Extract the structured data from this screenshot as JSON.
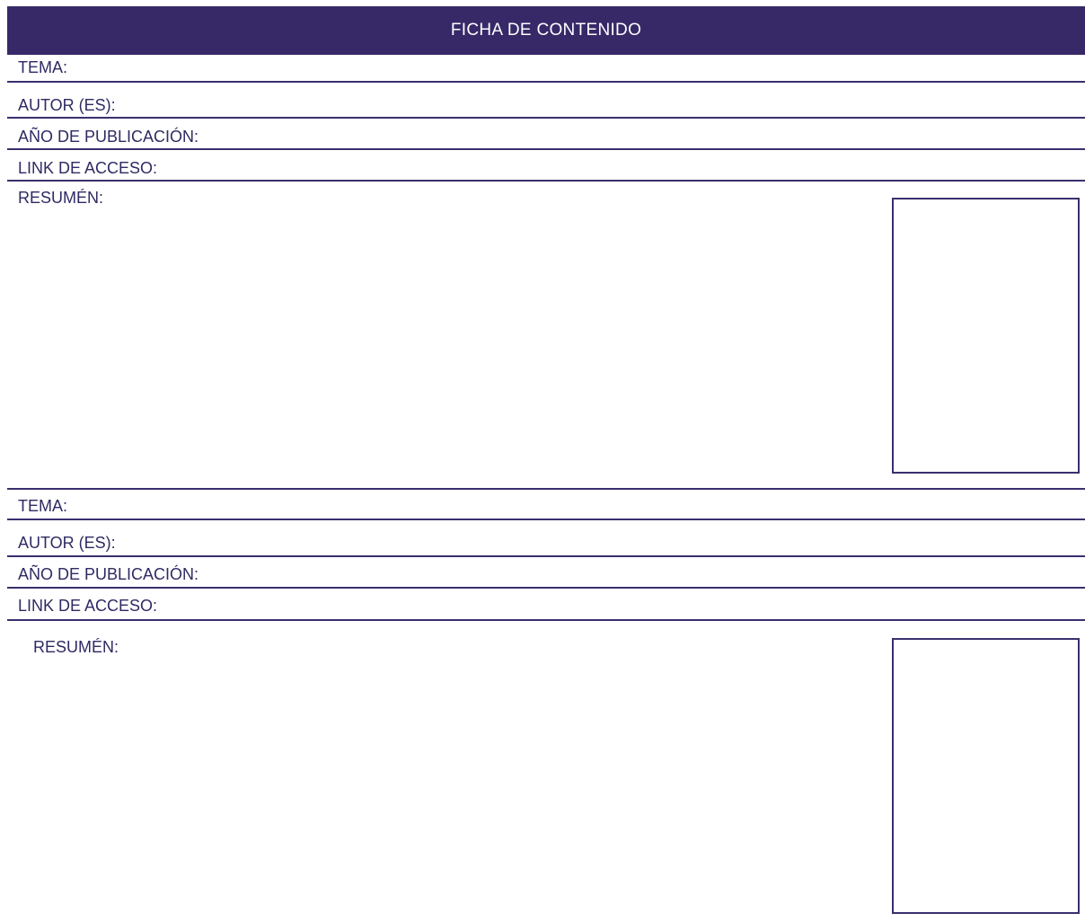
{
  "header": {
    "title": "FICHA DE CONTENIDO"
  },
  "card1": {
    "tema_label": "TEMA:",
    "autor_label": "AUTOR (ES):",
    "anio_label": "AÑO DE PUBLICACIÓN:",
    "link_label": "LINK DE ACCESO:",
    "resumen_label": "RESUMÉN:"
  },
  "card2": {
    "tema_label": "TEMA:",
    "autor_label": "AUTOR (ES):",
    "anio_label": "AÑO DE PUBLICACIÓN:",
    "link_label": "LINK DE ACCESO:",
    "resumen_label": "RESUMÉN:"
  },
  "colors": {
    "header_bg": "#372968",
    "line": "#3a2f6e",
    "text": "#2e2a63"
  }
}
